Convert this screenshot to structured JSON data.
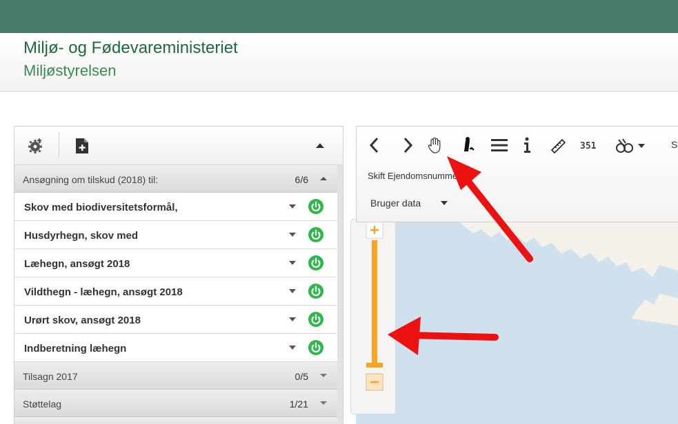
{
  "header": {
    "ministry": "Miljø- og Fødevareministeriet",
    "agency": "Miljøstyrelsen"
  },
  "colors": {
    "top_bar": "#4a7a68",
    "brand_green": "#1e6a3a",
    "power_green": "#2db84a",
    "zoom_orange": "#f6a623",
    "arrow_red": "#ee1111"
  },
  "left_panel": {
    "toolbar_icons": [
      "gear-icon",
      "new-document-icon",
      "collapse-icon"
    ],
    "group_2018": {
      "label": "Ansøgning om tilskud (2018) til:",
      "count": "6/6"
    },
    "items": [
      {
        "label": "Skov med biodiversitetsformål,"
      },
      {
        "label": "Husdyrhegn, skov med"
      },
      {
        "label": "Læhegn, ansøgt 2018"
      },
      {
        "label": "Vildthegn - læhegn, ansøgt 2018"
      },
      {
        "label": "Urørt skov, ansøgt 2018"
      },
      {
        "label": "Indberetning læhegn"
      }
    ],
    "group_tilsagn": {
      "label": "Tilsagn 2017",
      "count": "0/5"
    },
    "group_stottelag": {
      "label": "Støttelag",
      "count": "1/21"
    }
  },
  "toolbar": {
    "icons": [
      "back-icon",
      "forward-icon",
      "pan-hand-icon",
      "identify-icon",
      "layers-list-icon",
      "info-icon",
      "measure-icon",
      "coordinate-icon",
      "tools-icon"
    ],
    "measure_text": "351",
    "truncated_label": "S",
    "skift_label": "Skift Ejendomsnummer",
    "bruger_label": "Bruger data"
  }
}
